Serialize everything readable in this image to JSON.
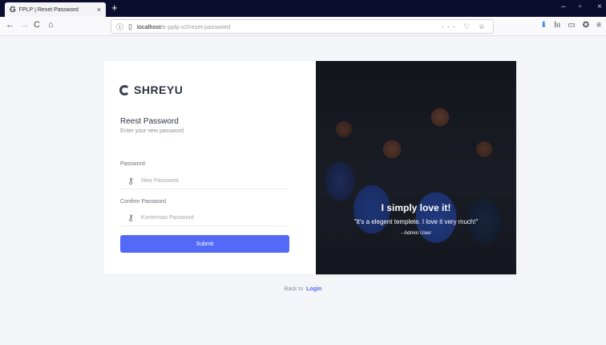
{
  "browser": {
    "tab_title": "FPLP | Reset Password",
    "tab_favicon": "G",
    "close_glyph": "×",
    "new_tab_glyph": "+",
    "url_host": "localhost",
    "url_path": "/e-pplp-v2/reset-password",
    "url_actions": "··· ♡ ☆",
    "nav": {
      "back": "←",
      "forward": "→",
      "reload": "C",
      "home": "⌂"
    },
    "window_controls": {
      "minimize": "–",
      "maximize": "▫",
      "close": "×"
    },
    "toolbar": {
      "download": "⬇",
      "library": "lıı",
      "sidebar": "▭",
      "account": "✪",
      "menu": "≡"
    },
    "icons": [
      "page-info-icon",
      "document-icon"
    ]
  },
  "brand": {
    "name": "SHREYU",
    "color": "#3a3f52"
  },
  "form": {
    "title": "Reest Password",
    "subtitle": "Enter your new password",
    "password_label": "Password",
    "password_placeholder": "New Password",
    "confirm_label": "Confirm Password",
    "confirm_placeholder": "Konfirmasi Password",
    "key_glyph": "⚷",
    "submit_label": "Submit",
    "accent": "#5369f8"
  },
  "testimonial": {
    "title": "I simply love it!",
    "quote": "\"It's a elegent templete. I love it very much!\"",
    "author": "- Admin User"
  },
  "footer": {
    "text": "Back to",
    "link": "Login"
  }
}
